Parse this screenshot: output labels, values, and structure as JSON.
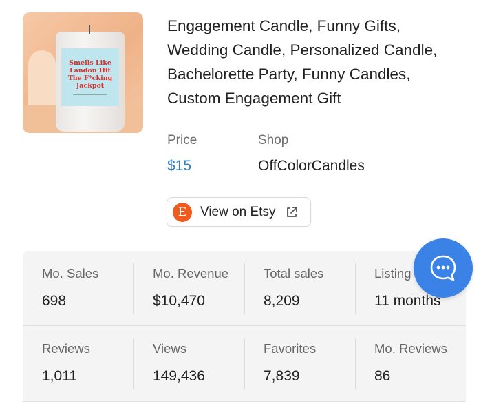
{
  "product": {
    "image_text": [
      "Smells Like",
      "Landon Hit",
      "The F*cking",
      "Jackpot"
    ],
    "title_lines": [
      "Engagement Candle, Funny Gifts,",
      "Wedding Candle, Personalized Candle,",
      "Bachelorette Party, Funny Candles,",
      "Custom Engagement Gift"
    ],
    "price_label": "Price",
    "price_value": "$15",
    "shop_label": "Shop",
    "shop_value": "OffColorCandles",
    "etsy_button": {
      "logo_letter": "E",
      "label": "View on Etsy"
    }
  },
  "stats": {
    "row1": [
      {
        "label": "Mo. Sales",
        "value": "698"
      },
      {
        "label": "Mo. Revenue",
        "value": "$10,470"
      },
      {
        "label": "Total sales",
        "value": "8,209"
      },
      {
        "label": "Listing",
        "value": "11 months"
      }
    ],
    "row2": [
      {
        "label": "Reviews",
        "value": "1,011"
      },
      {
        "label": "Views",
        "value": "149,436"
      },
      {
        "label": "Favorites",
        "value": "7,839"
      },
      {
        "label": "Mo. Reviews",
        "value": "86"
      }
    ]
  },
  "colors": {
    "price": "#2f7fc7",
    "etsy": "#ef5a1e",
    "chat_button": "#3b82e6",
    "stats_bg": "#f4f4f4"
  },
  "icons": {
    "external_link": "external-link-icon",
    "chat": "chat-bubble-icon"
  }
}
